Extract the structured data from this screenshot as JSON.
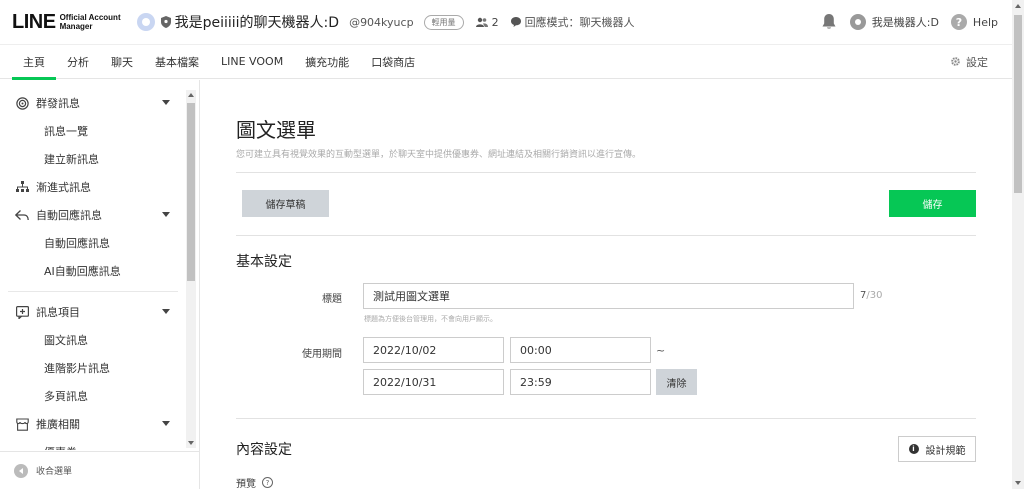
{
  "header": {
    "logo_main": "LINE",
    "logo_sub_line1": "Official Account",
    "logo_sub_line2": "Manager",
    "account_name": "我是peiiiii的聊天機器人:D",
    "account_id": "@904kyucp",
    "plan_badge": "輕用量",
    "friends_count": "2",
    "reply_mode": "回應模式：聊天機器人",
    "user_name": "我是機器人:D",
    "help_label": "Help",
    "icons": [
      "shield-icon",
      "friends-icon",
      "chat-bubble-icon",
      "bell-icon",
      "user-avatar-icon",
      "help-icon"
    ]
  },
  "nav": {
    "tabs": [
      {
        "label": "主頁",
        "active": true
      },
      {
        "label": "分析",
        "active": false
      },
      {
        "label": "聊天",
        "active": false
      },
      {
        "label": "基本檔案",
        "active": false
      },
      {
        "label": "LINE VOOM",
        "active": false
      },
      {
        "label": "擴充功能",
        "active": false
      },
      {
        "label": "口袋商店",
        "active": false
      }
    ],
    "settings_label": "設定"
  },
  "sidebar": {
    "groups": [
      {
        "label": "群發訊息",
        "icon": "broadcast-icon",
        "items": [
          "訊息一覽",
          "建立新訊息"
        ]
      },
      {
        "label": "漸進式訊息",
        "icon": "step-message-icon",
        "items": []
      },
      {
        "label": "自動回應訊息",
        "icon": "reply-icon",
        "items": [
          "自動回應訊息",
          "AI自動回應訊息"
        ]
      },
      {
        "label": "訊息項目",
        "icon": "message-items-icon",
        "items": [
          "圖文訊息",
          "進階影片訊息",
          "多頁訊息"
        ]
      },
      {
        "label": "推廣相關",
        "icon": "store-icon",
        "items": [
          "優惠券"
        ]
      }
    ],
    "collapse_label": "收合選單"
  },
  "main": {
    "title": "圖文選單",
    "description": "您可建立具有視覺效果的互動型選單，於聊天室中提供優惠券、網址連結及相關行銷資訊以進行宣傳。",
    "draft_button": "儲存草稿",
    "save_button": "儲存",
    "basic_section": "基本設定",
    "title_label": "標題",
    "title_value": "測試用圖文選單",
    "title_count": "7",
    "title_max": "/30",
    "title_hint": "標題為方便後台管理用，不會向用戶顯示。",
    "period_label": "使用期間",
    "start_date": "2022/10/02",
    "start_time": "00:00",
    "tilde": "~",
    "end_date": "2022/10/31",
    "end_time": "23:59",
    "clear_button": "清除",
    "content_section": "內容設定",
    "guide_button": "設計規範",
    "preview_label": "預覽"
  },
  "colors": {
    "accent": "#06c755",
    "button_gray": "#cfd4d9"
  }
}
